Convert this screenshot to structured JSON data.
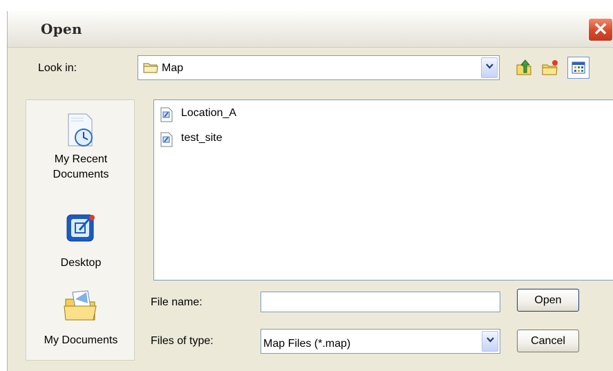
{
  "window": {
    "title": "Open",
    "close_label": "✕"
  },
  "look_in": {
    "label": "Look in:",
    "value": "Map"
  },
  "places": [
    {
      "label_line1": "My Recent",
      "label_line2": "Documents"
    },
    {
      "label_line1": "Desktop",
      "label_line2": ""
    },
    {
      "label_line1": "My Documents",
      "label_line2": ""
    }
  ],
  "files": [
    {
      "name": "Location_A"
    },
    {
      "name": "test_site"
    }
  ],
  "file_name": {
    "label": "File name:",
    "value": ""
  },
  "file_type": {
    "label": "Files of type:",
    "value": "Map Files (*.map)"
  },
  "buttons": {
    "open": "Open",
    "cancel": "Cancel"
  }
}
